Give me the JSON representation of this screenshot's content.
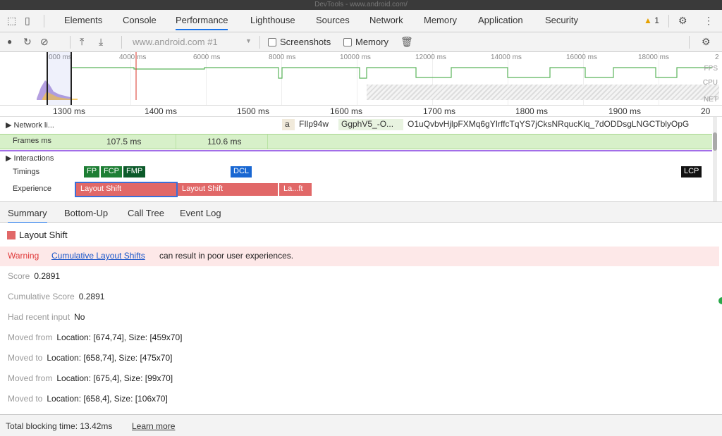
{
  "window": {
    "title": "DevTools - www.android.com/"
  },
  "tabs": [
    "Elements",
    "Console",
    "Performance",
    "Lighthouse",
    "Sources",
    "Network",
    "Memory",
    "Application",
    "Security"
  ],
  "active_tab": "Performance",
  "warnings_count": "1",
  "toolbar": {
    "url": "www.android.com #1",
    "screenshots_label": "Screenshots",
    "memory_label": "Memory"
  },
  "overview": {
    "ticks": [
      "000 ms",
      "4000 ms",
      "6000 ms",
      "8000 ms",
      "10000 ms",
      "12000 ms",
      "14000 ms",
      "16000 ms",
      "18000 ms",
      "2"
    ],
    "labels": {
      "fps": "FPS",
      "cpu": "CPU",
      "net": "NET"
    }
  },
  "ruler": [
    "1300 ms",
    "1400 ms",
    "1500 ms",
    "1600 ms",
    "1700 ms",
    "1800 ms",
    "1900 ms",
    "20"
  ],
  "tracks": {
    "network_label": "Network li...",
    "network_items": [
      "a",
      "FIlp94w",
      "GgphV5_-O...",
      "O1uQvbvHjlpFXMq6gYIrffcTqYS7jCksNRqucKlq_7dODDsgLNGCTblyOpG"
    ],
    "frames_label": "Frames",
    "frames_unit": "ms",
    "frames": [
      "107.5 ms",
      "110.6 ms"
    ],
    "interactions_label": "Interactions",
    "timings_label": "Timings",
    "timings": [
      "FP",
      "FCP",
      "FMP",
      "DCL",
      "LCP"
    ],
    "experience_label": "Experience",
    "experience": [
      "Layout Shift",
      "Layout Shift",
      "La...ft"
    ]
  },
  "bottom_tabs": [
    "Summary",
    "Bottom-Up",
    "Call Tree",
    "Event Log"
  ],
  "summary": {
    "title": "Layout Shift",
    "warning_label": "Warning",
    "warning_link": "Cumulative Layout Shifts",
    "warning_text": "can result in poor user experiences.",
    "rows": [
      {
        "k": "Score",
        "v": "0.2891"
      },
      {
        "k": "Cumulative Score",
        "v": "0.2891"
      },
      {
        "k": "Had recent input",
        "v": "No"
      },
      {
        "k": "Moved from",
        "v": "Location: [674,74], Size: [459x70]"
      },
      {
        "k": "Moved to",
        "v": "Location: [658,74], Size: [475x70]"
      },
      {
        "k": "Moved from",
        "v": "Location: [675,4], Size: [99x70]"
      },
      {
        "k": "Moved to",
        "v": "Location: [658,4], Size: [106x70]"
      }
    ]
  },
  "status": {
    "text": "Total blocking time: 13.42ms",
    "link": "Learn more"
  }
}
